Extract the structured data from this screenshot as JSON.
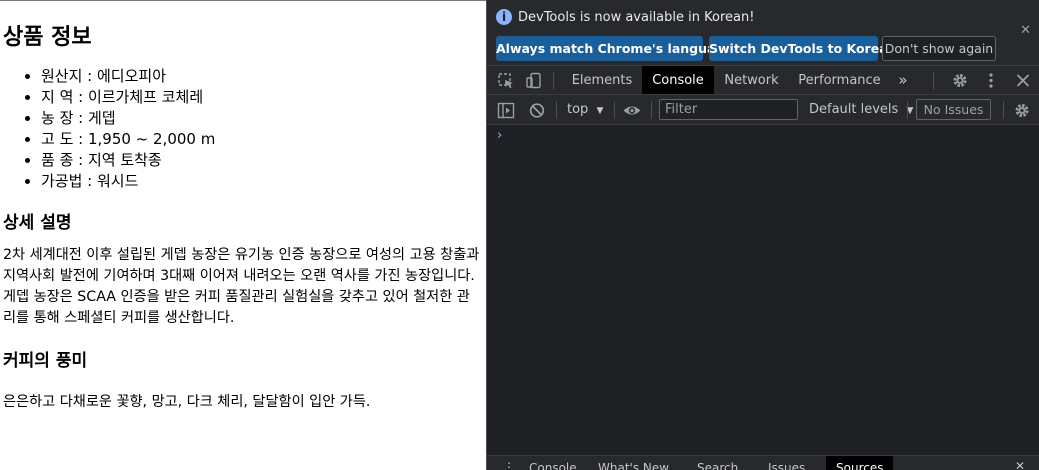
{
  "page": {
    "title": "상품 정보",
    "info_items": [
      "원산지 : 에디오피아",
      "지 역 : 이르가체프 코체레",
      "농 장 : 게뎁",
      "고 도 : 1,950 ~ 2,000 m",
      "품 종 : 지역 토착종",
      "가공법 : 워시드"
    ],
    "description_heading": "상세 설명",
    "description_text": "2차 세계대전 이후 설립된 게뎁 농장은 유기농 인증 농장으로 여성의 고용 창출과 지역사회 발전에 기여하며 3대째 이어져 내려오는 오랜 역사를 가진 농장입니다. 게뎁 농장은 SCAA 인증을 받은 커피 품질관리 실험실을 갖추고 있어 철저한 관리를 통해 스페셜티 커피를 생산합니다.",
    "flavor_heading": "커피의 풍미",
    "flavor_text": "은은하고 다채로운 꽃향, 망고, 다크 체리, 달달함이 입안 가득."
  },
  "devtools": {
    "infobar": {
      "message": "DevTools is now available in Korean!",
      "btn_match": "Always match Chrome's language",
      "btn_switch": "Switch DevTools to Korean",
      "btn_dismiss": "Don't show again",
      "close_glyph": "✕"
    },
    "tabs": {
      "elements": "Elements",
      "console": "Console",
      "network": "Network",
      "performance": "Performance",
      "more_glyph": "»"
    },
    "toolbar": {
      "context": "top",
      "filter_placeholder": "Filter",
      "levels": "Default levels",
      "issues": "No Issues",
      "dropdown_glyph": "▼"
    },
    "console": {
      "prompt_glyph": "›"
    },
    "drawer_tabs": [
      "Console",
      "What's New",
      "Search",
      "Issues",
      "Sources"
    ],
    "colors": {
      "panel_bg": "#202124",
      "toolbar_bg": "#28292c",
      "primary_button": "#1a5e9a",
      "accent_blue": "#8ab4f8"
    }
  }
}
